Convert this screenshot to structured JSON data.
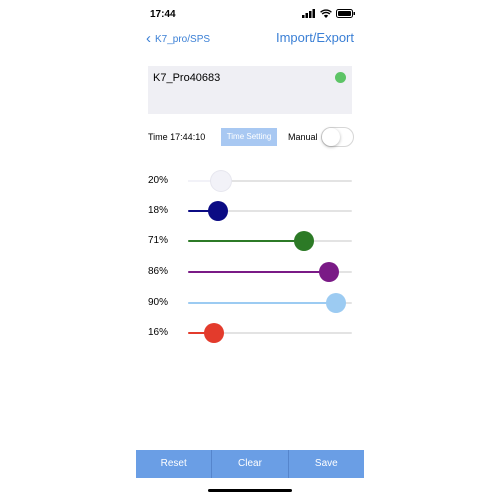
{
  "status_bar": {
    "time": "17:44"
  },
  "nav": {
    "back_label": "K7_pro/SPS",
    "back_icon": "chevron-left-icon",
    "action_label": "Import/Export"
  },
  "device": {
    "name": "K7_Pro40683",
    "status_color": "#5dc466"
  },
  "time_row": {
    "time_text": "Time 17:44:10",
    "time_setting_label": "Time Setting",
    "manual_label": "Manual",
    "manual_on": false
  },
  "sliders": [
    {
      "label": "20%",
      "value": 20,
      "color": "#f2f2f8"
    },
    {
      "label": "18%",
      "value": 18,
      "color": "#0b0b84"
    },
    {
      "label": "71%",
      "value": 71,
      "color": "#2c7a26"
    },
    {
      "label": "86%",
      "value": 86,
      "color": "#7a1a86"
    },
    {
      "label": "90%",
      "value": 90,
      "color": "#9ccbf2"
    },
    {
      "label": "16%",
      "value": 16,
      "color": "#e33b2c"
    }
  ],
  "toolbar": {
    "reset_label": "Reset",
    "clear_label": "Clear",
    "save_label": "Save",
    "color": "#6a9ee5"
  }
}
